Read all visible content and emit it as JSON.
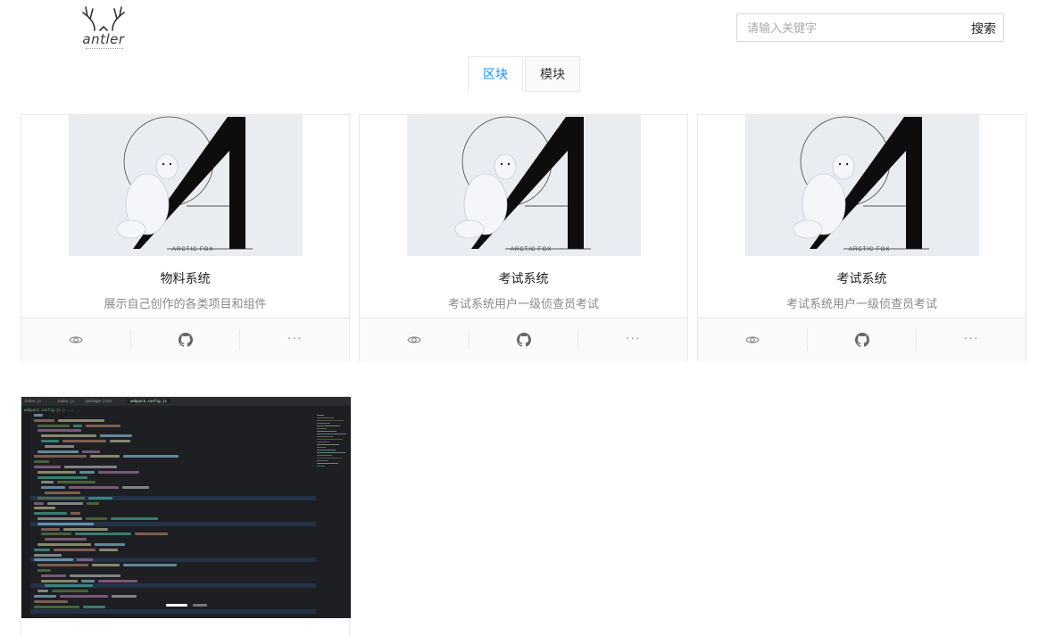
{
  "header": {
    "logo_text": "antler",
    "search": {
      "placeholder": "请输入关键字",
      "value": "",
      "button_label": "搜索"
    }
  },
  "tabs": [
    {
      "label": "区块",
      "active": true
    },
    {
      "label": "模块",
      "active": false
    }
  ],
  "cover": {
    "caption": "ARCTIC FOX"
  },
  "cards": [
    {
      "title": "物料系统",
      "description": "展示自己创作的各类项目和组件"
    },
    {
      "title": "考试系统",
      "description": "考试系统用户一级侦查员考试"
    },
    {
      "title": "考试系统",
      "description": "考试系统用户一级侦查员考试"
    }
  ],
  "card_actions": {
    "preview_icon": "eye-icon",
    "github_icon": "github-icon",
    "more_icon": "ellipsis-icon",
    "more_label": "···"
  },
  "code_preview": {
    "editor_tabs": [
      "index.js",
      "index.js",
      "package.json",
      "webpack.config.js"
    ],
    "breadcrumb": "webpack.config.js > ...",
    "carousel": {
      "count": 2,
      "active": 0
    }
  },
  "colors": {
    "accent": "#1890ff",
    "border": "#e8e8e8",
    "cover_bg": "#e9ecf1",
    "editor_bg": "#1e1f22"
  }
}
